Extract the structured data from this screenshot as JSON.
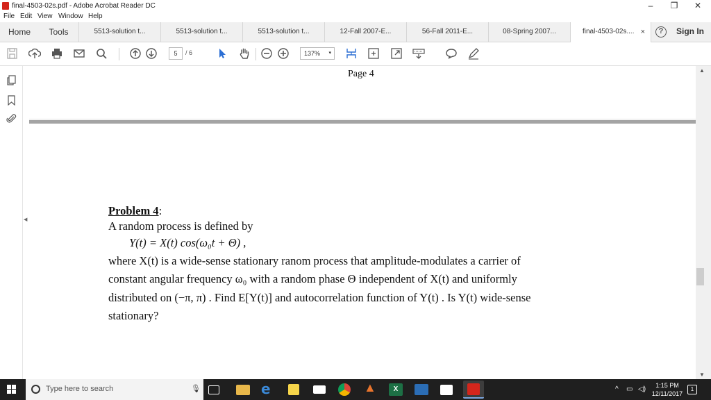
{
  "window": {
    "title": "final-4503-02s.pdf - Adobe Acrobat Reader DC",
    "minimize": "–",
    "restore": "❐",
    "close": "✕"
  },
  "menu": [
    "File",
    "Edit",
    "View",
    "Window",
    "Help"
  ],
  "tabs": {
    "home": "Home",
    "tools": "Tools",
    "docs": [
      "5513-solution t...",
      "5513-solution t...",
      "5513-solution t...",
      "12-Fall 2007-E...",
      "56-Fall 2011-E...",
      "08-Spring 2007...",
      "final-4503-02s...."
    ],
    "close_glyph": "×",
    "help": "?",
    "sign_in": "Sign In"
  },
  "toolbar": {
    "current_page": "5",
    "total_pages": "/ 6",
    "zoom": "137%",
    "zoom_arrow": "▾"
  },
  "document": {
    "page_label": "Page 4",
    "problem_title": "Problem 4",
    "problem_colon": ":",
    "line1": "A random process is defined by",
    "equation": "Y(t) = X(t) cos(ω₀t + Θ) ,",
    "line3": "where  X(t)  is a wide-sense stationary ranom process that amplitude-modulates a carrier of",
    "line4": "constant angular frequency  ω₀  with a random phase  Θ  independent of  X(t)  and uniformly",
    "line5": "distributed on  (−π, π) . Find  E[Y(t)]  and autocorrelation function of  Y(t) . Is  Y(t) wide-sense",
    "line6": "stationary?"
  },
  "taskbar": {
    "search_placeholder": "Type here to search",
    "time": "1:15 PM",
    "date": "12/11/2017",
    "notifications": "1",
    "tray_chevron": "^"
  },
  "colors": {
    "acrobat_red": "#d4261c",
    "taskbar": "#1f1f1f",
    "separator": "#a4a4a4"
  },
  "icons": [
    "app-icon",
    "save-icon",
    "upload-icon",
    "print-icon",
    "email-icon",
    "search-icon",
    "page-up-icon",
    "page-down-icon",
    "select-arrow-icon",
    "hand-icon",
    "zoom-out-icon",
    "zoom-in-icon",
    "fit-page-icon",
    "fit-width-icon",
    "fullscreen-icon",
    "keyboard-icon",
    "comment-icon",
    "pen-icon",
    "copy-pages-icon",
    "bookmark-icon",
    "attachment-icon"
  ]
}
